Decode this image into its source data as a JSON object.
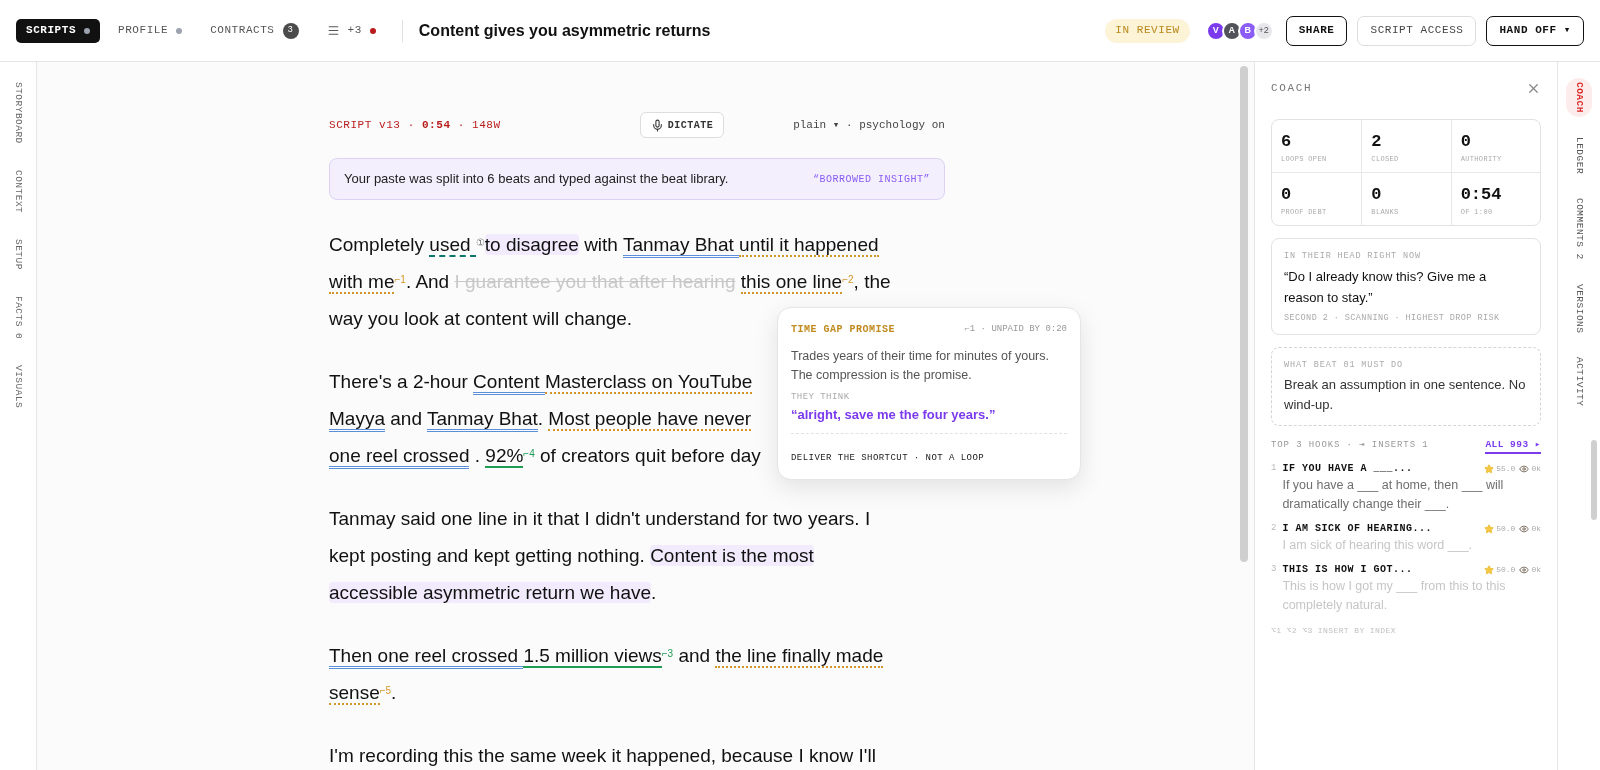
{
  "top_bar": {
    "tabs": [
      {
        "label": "SCRIPTS",
        "selected": true,
        "kind": "dot",
        "color": "#9ca3af"
      },
      {
        "label": "PROFILE",
        "selected": false,
        "kind": "dot",
        "color": "#9ca3af"
      },
      {
        "label": "CONTRACTS",
        "selected": false,
        "kind": "count",
        "count": "3"
      },
      {
        "label": "+3",
        "selected": false,
        "kind": "more",
        "color": "#b91c1c"
      }
    ],
    "title": "Content gives you asymmetric returns",
    "status": "IN REVIEW",
    "avatars": [
      {
        "initial": "V",
        "color": "#7c3aed"
      },
      {
        "initial": "A",
        "color": "#52525b"
      },
      {
        "initial": "B",
        "color": "#8b5cf6"
      }
    ],
    "avatar_overflow": "+2",
    "buttons": [
      {
        "label": "SHARE",
        "kind": "outline"
      },
      {
        "label": "SCRIPT ACCESS",
        "kind": "muted"
      },
      {
        "label": "HAND OFF ▾",
        "kind": "outline"
      }
    ]
  },
  "left_rail": [
    {
      "label": "STORYBOARD"
    },
    {
      "label": "CONTEXT"
    },
    {
      "label": "SETUP"
    },
    {
      "label": "FACTS 0"
    },
    {
      "label": "VISUALS"
    }
  ],
  "editor": {
    "meta": "SCRIPT v13 · **0:54** · 148W",
    "dictate": "DICTATE",
    "mode": "plain ▾ · psychology on",
    "banner": {
      "text": "Your paste was split into 6 beats and typed against the beat library.",
      "tag": "“BORROWED INSIGHT”"
    },
    "paragraphs": [
      {
        "lines": [
          [
            {
              "kind": "plain",
              "text": "Completely "
            },
            {
              "kind": "hedge",
              "text": "used",
              "mark": "①",
              "space_after": true
            },
            {
              "kind": "highlight",
              "text": "to disagree"
            },
            {
              "kind": "plain",
              "text": " with "
            },
            {
              "kind": "entity",
              "text": "Tanmay Bhat",
              "space_after": true
            },
            {
              "kind": "claim",
              "text": "until it happened"
            }
          ],
          [
            {
              "kind": "claim",
              "text": "with me",
              "mark": "⌐1"
            },
            {
              "kind": "plain",
              "text": ". And "
            },
            {
              "kind": "cut",
              "text": "I guarantee you that after hearing",
              "space_after": true
            },
            {
              "kind": "claim",
              "text": "this one line",
              "mark": "⌐2"
            },
            {
              "kind": "plain",
              "text": ", the"
            }
          ],
          [
            {
              "kind": "plain",
              "text": "way you look at content will change."
            }
          ]
        ]
      },
      {
        "lines": [
          [
            {
              "kind": "plain",
              "text": "There's a 2-hour "
            },
            {
              "kind": "entity",
              "text": "Content",
              "space_after": true
            },
            {
              "kind": "claim",
              "text": "Masterclass on YouTube"
            }
          ],
          [
            {
              "kind": "entity",
              "text": "Mayya"
            },
            {
              "kind": "plain",
              "text": " and "
            },
            {
              "kind": "entity",
              "text": "Tanmay Bhat"
            },
            {
              "kind": "plain",
              "text": ". "
            },
            {
              "kind": "claim",
              "text": "Most people have never"
            }
          ],
          [
            {
              "kind": "entity",
              "text": "one reel crossed"
            },
            {
              "kind": "plain",
              "text": " . "
            },
            {
              "kind": "stat",
              "text": "92%",
              "mark": "⌐4"
            },
            {
              "kind": "plain",
              "text": " of creators quit before day"
            }
          ]
        ]
      },
      {
        "lines": [
          [
            {
              "kind": "plain",
              "text": "Tanmay said one line in it that I didn't understand for two years. I"
            }
          ],
          [
            {
              "kind": "plain",
              "text": "kept posting and kept getting nothing. "
            },
            {
              "kind": "highlight",
              "text": "Content is the most"
            }
          ],
          [
            {
              "kind": "highlight",
              "text": "accessible asymmetric return we have"
            },
            {
              "kind": "plain",
              "text": "."
            }
          ]
        ]
      },
      {
        "lines": [
          [
            {
              "kind": "entity",
              "text": "Then one reel crossed",
              "space_after": true
            },
            {
              "kind": "stat",
              "text": "1.5 million views",
              "mark": "⌐3"
            },
            {
              "kind": "plain",
              "text": " and "
            },
            {
              "kind": "claim",
              "text": "the line finally made"
            }
          ],
          [
            {
              "kind": "claim",
              "text": "sense",
              "mark": "⌐5"
            },
            {
              "kind": "plain",
              "text": "."
            }
          ]
        ]
      },
      {
        "lines": [
          [
            {
              "kind": "plain",
              "text": "I'm recording this the same week it happened, because I know I'll"
            }
          ]
        ]
      }
    ]
  },
  "tooltip": {
    "title": "TIME GAP PROMISE",
    "meta": "⌐1 · UNPAID BY 0:20",
    "body": "Trades years of their time for minutes of yours. The compression is the promise.",
    "think_label": "THEY THINK",
    "think": "“alright, save me the four years.”",
    "footer": "DELIVER THE SHORTCUT · NOT A LOOP"
  },
  "coach": {
    "title": "COACH",
    "stats": [
      {
        "value": "6",
        "label": "LOOPS OPEN"
      },
      {
        "value": "2",
        "label": "CLOSED"
      },
      {
        "value": "0",
        "label": "AUTHORITY"
      },
      {
        "value": "0",
        "label": "PROOF DEBT"
      },
      {
        "value": "0",
        "label": "BLANKS"
      },
      {
        "value": "0:54",
        "label": "OF 1:00"
      }
    ],
    "head": {
      "label": "IN THEIR HEAD RIGHT NOW",
      "quote": "“Do I already know this? Give me a reason to stay.”",
      "meta": "SECOND 2 · SCANNING · HIGHEST DROP RISK"
    },
    "beat": {
      "label": "WHAT BEAT 01 MUST DO",
      "text": "Break an assumption in one sentence. No wind-up."
    },
    "hooks_header": "TOP 3 HOOKS · ⇥ INSERTS 1",
    "hooks_link": "ALL 993 ▸",
    "hooks": [
      {
        "index": "1",
        "title": "IF YOU HAVE A ___...",
        "score": "55.0",
        "views": "0k",
        "text": "If you have a ___ at home, then ___ will dramatically change their ___.",
        "selected": true
      },
      {
        "index": "2",
        "title": "I AM SICK OF HEARING...",
        "score": "50.0",
        "views": "0k",
        "text": "I am sick of hearing this word ___.",
        "selected": false
      },
      {
        "index": "3",
        "title": "THIS IS HOW I GOT...",
        "score": "50.0",
        "views": "0k",
        "text": "This is how I got my ___ from this to this completely natural.",
        "selected": false
      }
    ],
    "shortcut_hint": "⌥1 ⌥2 ⌥3 INSERT BY INDEX"
  },
  "right_rail": [
    {
      "label": "COACH",
      "selected": true
    },
    {
      "label": "LEDGER",
      "selected": false
    },
    {
      "label": "COMMENTS 2",
      "selected": false
    },
    {
      "label": "VERSIONS",
      "selected": false
    },
    {
      "label": "ACTIVITY",
      "selected": false
    }
  ]
}
